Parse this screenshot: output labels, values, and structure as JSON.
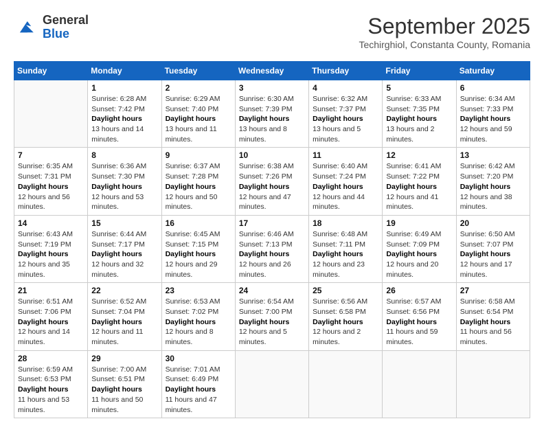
{
  "logo": {
    "general": "General",
    "blue": "Blue"
  },
  "title": "September 2025",
  "subtitle": "Techirghiol, Constanta County, Romania",
  "weekdays": [
    "Sunday",
    "Monday",
    "Tuesday",
    "Wednesday",
    "Thursday",
    "Friday",
    "Saturday"
  ],
  "weeks": [
    [
      {
        "day": "",
        "empty": true
      },
      {
        "day": "1",
        "sunrise": "6:28 AM",
        "sunset": "7:42 PM",
        "daylight": "13 hours and 14 minutes."
      },
      {
        "day": "2",
        "sunrise": "6:29 AM",
        "sunset": "7:40 PM",
        "daylight": "13 hours and 11 minutes."
      },
      {
        "day": "3",
        "sunrise": "6:30 AM",
        "sunset": "7:39 PM",
        "daylight": "13 hours and 8 minutes."
      },
      {
        "day": "4",
        "sunrise": "6:32 AM",
        "sunset": "7:37 PM",
        "daylight": "13 hours and 5 minutes."
      },
      {
        "day": "5",
        "sunrise": "6:33 AM",
        "sunset": "7:35 PM",
        "daylight": "13 hours and 2 minutes."
      },
      {
        "day": "6",
        "sunrise": "6:34 AM",
        "sunset": "7:33 PM",
        "daylight": "12 hours and 59 minutes."
      }
    ],
    [
      {
        "day": "7",
        "sunrise": "6:35 AM",
        "sunset": "7:31 PM",
        "daylight": "12 hours and 56 minutes."
      },
      {
        "day": "8",
        "sunrise": "6:36 AM",
        "sunset": "7:30 PM",
        "daylight": "12 hours and 53 minutes."
      },
      {
        "day": "9",
        "sunrise": "6:37 AM",
        "sunset": "7:28 PM",
        "daylight": "12 hours and 50 minutes."
      },
      {
        "day": "10",
        "sunrise": "6:38 AM",
        "sunset": "7:26 PM",
        "daylight": "12 hours and 47 minutes."
      },
      {
        "day": "11",
        "sunrise": "6:40 AM",
        "sunset": "7:24 PM",
        "daylight": "12 hours and 44 minutes."
      },
      {
        "day": "12",
        "sunrise": "6:41 AM",
        "sunset": "7:22 PM",
        "daylight": "12 hours and 41 minutes."
      },
      {
        "day": "13",
        "sunrise": "6:42 AM",
        "sunset": "7:20 PM",
        "daylight": "12 hours and 38 minutes."
      }
    ],
    [
      {
        "day": "14",
        "sunrise": "6:43 AM",
        "sunset": "7:19 PM",
        "daylight": "12 hours and 35 minutes."
      },
      {
        "day": "15",
        "sunrise": "6:44 AM",
        "sunset": "7:17 PM",
        "daylight": "12 hours and 32 minutes."
      },
      {
        "day": "16",
        "sunrise": "6:45 AM",
        "sunset": "7:15 PM",
        "daylight": "12 hours and 29 minutes."
      },
      {
        "day": "17",
        "sunrise": "6:46 AM",
        "sunset": "7:13 PM",
        "daylight": "12 hours and 26 minutes."
      },
      {
        "day": "18",
        "sunrise": "6:48 AM",
        "sunset": "7:11 PM",
        "daylight": "12 hours and 23 minutes."
      },
      {
        "day": "19",
        "sunrise": "6:49 AM",
        "sunset": "7:09 PM",
        "daylight": "12 hours and 20 minutes."
      },
      {
        "day": "20",
        "sunrise": "6:50 AM",
        "sunset": "7:07 PM",
        "daylight": "12 hours and 17 minutes."
      }
    ],
    [
      {
        "day": "21",
        "sunrise": "6:51 AM",
        "sunset": "7:06 PM",
        "daylight": "12 hours and 14 minutes."
      },
      {
        "day": "22",
        "sunrise": "6:52 AM",
        "sunset": "7:04 PM",
        "daylight": "12 hours and 11 minutes."
      },
      {
        "day": "23",
        "sunrise": "6:53 AM",
        "sunset": "7:02 PM",
        "daylight": "12 hours and 8 minutes."
      },
      {
        "day": "24",
        "sunrise": "6:54 AM",
        "sunset": "7:00 PM",
        "daylight": "12 hours and 5 minutes."
      },
      {
        "day": "25",
        "sunrise": "6:56 AM",
        "sunset": "6:58 PM",
        "daylight": "12 hours and 2 minutes."
      },
      {
        "day": "26",
        "sunrise": "6:57 AM",
        "sunset": "6:56 PM",
        "daylight": "11 hours and 59 minutes."
      },
      {
        "day": "27",
        "sunrise": "6:58 AM",
        "sunset": "6:54 PM",
        "daylight": "11 hours and 56 minutes."
      }
    ],
    [
      {
        "day": "28",
        "sunrise": "6:59 AM",
        "sunset": "6:53 PM",
        "daylight": "11 hours and 53 minutes."
      },
      {
        "day": "29",
        "sunrise": "7:00 AM",
        "sunset": "6:51 PM",
        "daylight": "11 hours and 50 minutes."
      },
      {
        "day": "30",
        "sunrise": "7:01 AM",
        "sunset": "6:49 PM",
        "daylight": "11 hours and 47 minutes."
      },
      {
        "day": "",
        "empty": true
      },
      {
        "day": "",
        "empty": true
      },
      {
        "day": "",
        "empty": true
      },
      {
        "day": "",
        "empty": true
      }
    ]
  ]
}
